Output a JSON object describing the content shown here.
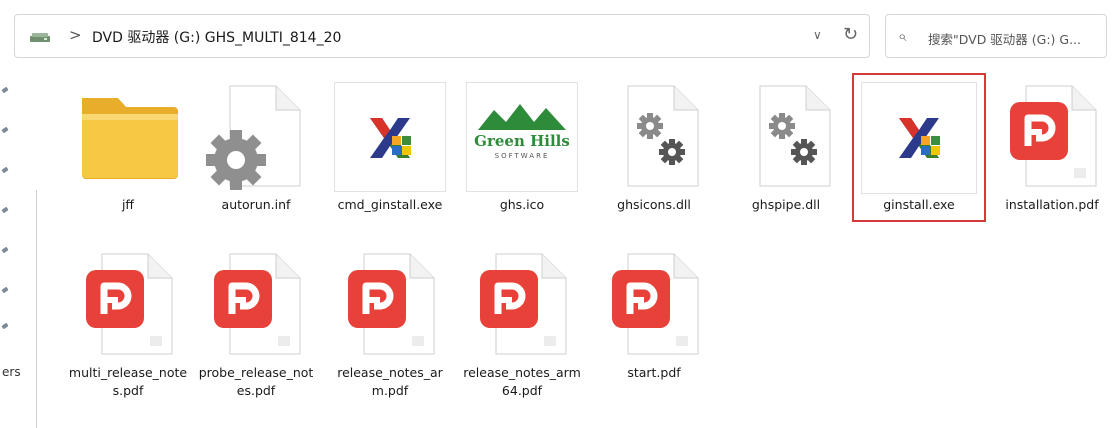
{
  "address_bar": {
    "drive_icon": "dvd-drive-icon",
    "separator": ">",
    "path": "DVD 驱动器 (G:) GHS_MULTI_814_20",
    "dropdown_icon": "chevron-down-icon",
    "refresh_icon": "refresh-icon"
  },
  "search": {
    "icon": "search-icon",
    "placeholder": "搜索\"DVD 驱动器 (G:) G..."
  },
  "sidebar": {
    "label": "ers"
  },
  "files": [
    {
      "name": "jff",
      "type": "folder"
    },
    {
      "name": "autorun.inf",
      "type": "settings-file"
    },
    {
      "name": "cmd_ginstall.exe",
      "type": "installer-exe"
    },
    {
      "name": "ghs.ico",
      "type": "image-icon"
    },
    {
      "name": "ghsicons.dll",
      "type": "dll"
    },
    {
      "name": "ghspipe.dll",
      "type": "dll"
    },
    {
      "name": "ginstall.exe",
      "type": "installer-exe",
      "selected": true
    },
    {
      "name": "installation.pdf",
      "type": "pdf"
    },
    {
      "name": "multi_release_notes.pdf",
      "type": "pdf"
    },
    {
      "name": "probe_release_notes.pdf",
      "type": "pdf"
    },
    {
      "name": "release_notes_arm.pdf",
      "type": "pdf"
    },
    {
      "name": "release_notes_arm64.pdf",
      "type": "pdf"
    },
    {
      "name": "start.pdf",
      "type": "pdf"
    }
  ],
  "ghs_logo": {
    "line1": "Green Hills",
    "line2": "SOFTWARE"
  },
  "colors": {
    "selection_border": "#d73838",
    "pdf_red": "#e8413a",
    "folder": "#f6c844"
  }
}
